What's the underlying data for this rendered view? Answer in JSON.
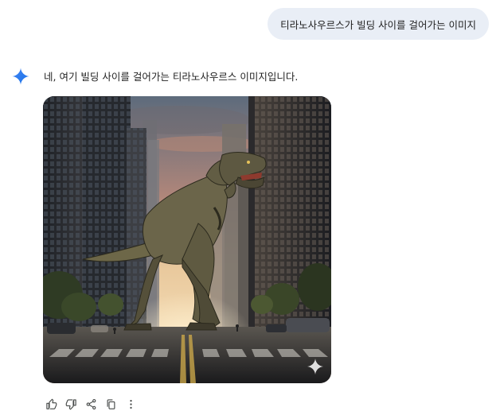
{
  "conversation": {
    "user_message": "티라노사우르스가 빌딩 사이를 걸어가는 이미지",
    "assistant_message": "네, 여기 빌딩 사이를 걸어가는 티라노사우르스 이미지입니다."
  },
  "icons": {
    "assistant_avatar": "gemini-sparkle-icon",
    "watermark": "sparkle-watermark-icon",
    "actions": [
      "thumbs-up-icon",
      "thumbs-down-icon",
      "share-icon",
      "copy-icon",
      "more-vert-icon"
    ]
  },
  "colors": {
    "user_bubble": "#e9eef6",
    "sparkle_blue": "#4285f4",
    "icon_gray": "#444746",
    "text": "#1f1f1f"
  }
}
